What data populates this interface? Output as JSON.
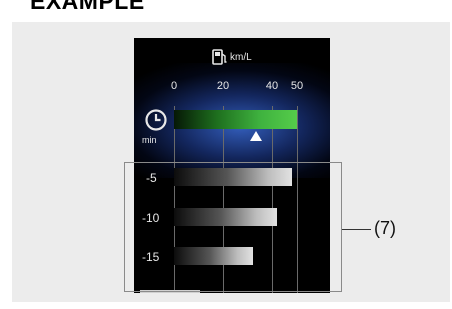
{
  "heading": "EXAMPLE",
  "display": {
    "unit_label": "km/L",
    "axis_ticks": [
      "0",
      "20",
      "40",
      "50"
    ],
    "time_unit": "min",
    "current": {
      "value": 50
    },
    "history": [
      {
        "label": "-5",
        "value": 48
      },
      {
        "label": "-10",
        "value": 42
      },
      {
        "label": "-15",
        "value": 32
      }
    ]
  },
  "callout": {
    "label": "(7)"
  },
  "icons": [
    "fuel-pump-icon",
    "clock-icon",
    "triangle-marker-icon"
  ],
  "colors": {
    "current_bar": "#55cc4a",
    "history_bar": "#e2e2e2",
    "screen_bg": "#000000",
    "panel_bg": "#ececec"
  }
}
